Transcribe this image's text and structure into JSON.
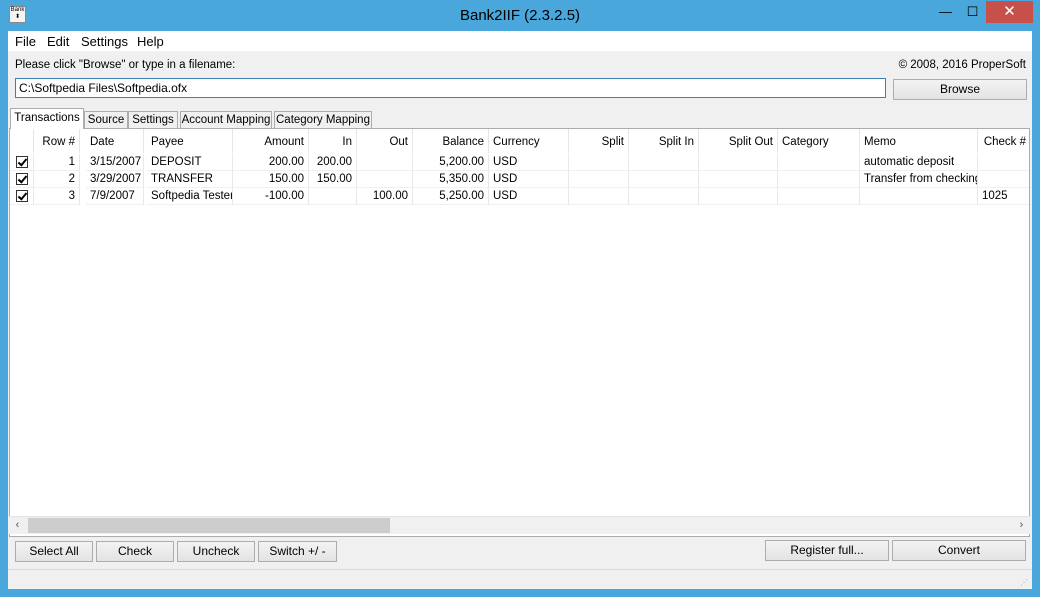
{
  "window": {
    "title": "Bank2IIF (2.3.2.5)",
    "icon_text": "Bank",
    "controls": {
      "minimize": "—",
      "maximize": "☐",
      "close": "✕"
    }
  },
  "menu": [
    "File",
    "Edit",
    "Settings",
    "Help"
  ],
  "file_prompt": "Please click \"Browse\" or type in a filename:",
  "copyright": "© 2008, 2016 ProperSoft",
  "file_path": "C:\\Softpedia Files\\Softpedia.ofx",
  "browse_label": "Browse",
  "tabs": [
    "Transactions",
    "Source",
    "Settings",
    "Account Mapping",
    "Category Mapping"
  ],
  "active_tab": "Transactions",
  "columns": [
    "Row #",
    "Date",
    "Payee",
    "Amount",
    "In",
    "Out",
    "Balance",
    "Currency",
    "Split",
    "Split In",
    "Split Out",
    "Category",
    "Memo",
    "Check #"
  ],
  "rows": [
    {
      "checked": true,
      "row": "1",
      "date": "3/15/2007",
      "payee": "DEPOSIT",
      "amount": "200.00",
      "in": "200.00",
      "out": "",
      "balance": "5,200.00",
      "currency": "USD",
      "split": "",
      "split_in": "",
      "split_out": "",
      "category": "",
      "memo": "automatic deposit",
      "check": ""
    },
    {
      "checked": true,
      "row": "2",
      "date": "3/29/2007",
      "payee": "TRANSFER",
      "amount": "150.00",
      "in": "150.00",
      "out": "",
      "balance": "5,350.00",
      "currency": "USD",
      "split": "",
      "split_in": "",
      "split_out": "",
      "category": "",
      "memo": "Transfer from checking",
      "check": ""
    },
    {
      "checked": true,
      "row": "3",
      "date": "7/9/2007",
      "payee": "Softpedia Tester",
      "amount": "-100.00",
      "in": "",
      "out": "100.00",
      "balance": "5,250.00",
      "currency": "USD",
      "split": "",
      "split_in": "",
      "split_out": "",
      "category": "",
      "memo": "",
      "check": "1025"
    }
  ],
  "scroll": {
    "left": "‹",
    "right": "›"
  },
  "buttons": {
    "select_all": "Select All",
    "check": "Check",
    "uncheck": "Uncheck",
    "switch": "Switch +/ -",
    "register": "Register full...",
    "convert": "Convert"
  }
}
